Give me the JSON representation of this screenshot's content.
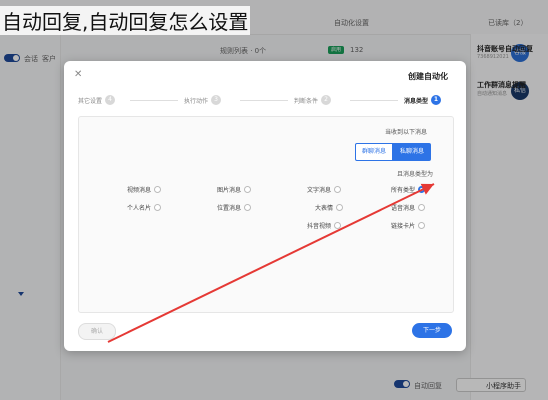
{
  "caption": "自动回复,自动回复怎么设置",
  "background": {
    "header_left": "自动化设置",
    "header_right": "已读库（2）",
    "subheader_left": "规则列表 · 0个",
    "badge_right": "启用",
    "count_text": "132",
    "sidebar_tabs": [
      "会话",
      "客户"
    ],
    "list_items": [
      {
        "avatar": "客服",
        "title": "抖音账号自动回复",
        "sub": "7368912021"
      },
      {
        "avatar": "私信",
        "title": "工作群消息提醒",
        "sub": "自动通知消息"
      }
    ],
    "bottom_toggle_label": "自动回复",
    "bottom_dropdown": "小程序助手"
  },
  "modal": {
    "title": "创建自动化",
    "steps": [
      {
        "num": "1",
        "label": "消息类型",
        "active": true
      },
      {
        "num": "2",
        "label": "判断条件",
        "active": false
      },
      {
        "num": "3",
        "label": "执行动作",
        "active": false
      },
      {
        "num": "4",
        "label": "其它设置",
        "active": false
      }
    ],
    "section1_label": "当收到以下消息",
    "segments": {
      "on": "私聊消息",
      "off": "群聊消息"
    },
    "section2_label": "且消息类型为",
    "options": [
      [
        "所有类型",
        "文字消息",
        "图片消息",
        "视频消息"
      ],
      [
        "语音消息",
        "大表情",
        "位置消息",
        "个人名片"
      ],
      [
        "链接卡片",
        "抖音视频"
      ]
    ],
    "selected_option": "所有类型",
    "confirm_button": "确认",
    "next_button": "下一步"
  }
}
